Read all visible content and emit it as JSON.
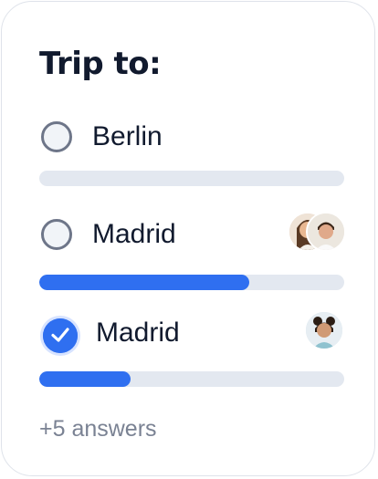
{
  "poll": {
    "title": "Trip to:",
    "options": [
      {
        "label": "Berlin",
        "selected": false,
        "progress": 0.0,
        "voters": 0
      },
      {
        "label": "Madrid",
        "selected": false,
        "progress": 0.69,
        "voters": 2
      },
      {
        "label": "Madrid",
        "selected": true,
        "progress": 0.3,
        "voters": 1
      }
    ],
    "more_answers": "+5 answers"
  },
  "colors": {
    "accent": "#2f6ff0",
    "track": "#e3e8f0",
    "title": "#111a2e",
    "muted": "#7a8293",
    "radio_border": "#6e7689"
  }
}
